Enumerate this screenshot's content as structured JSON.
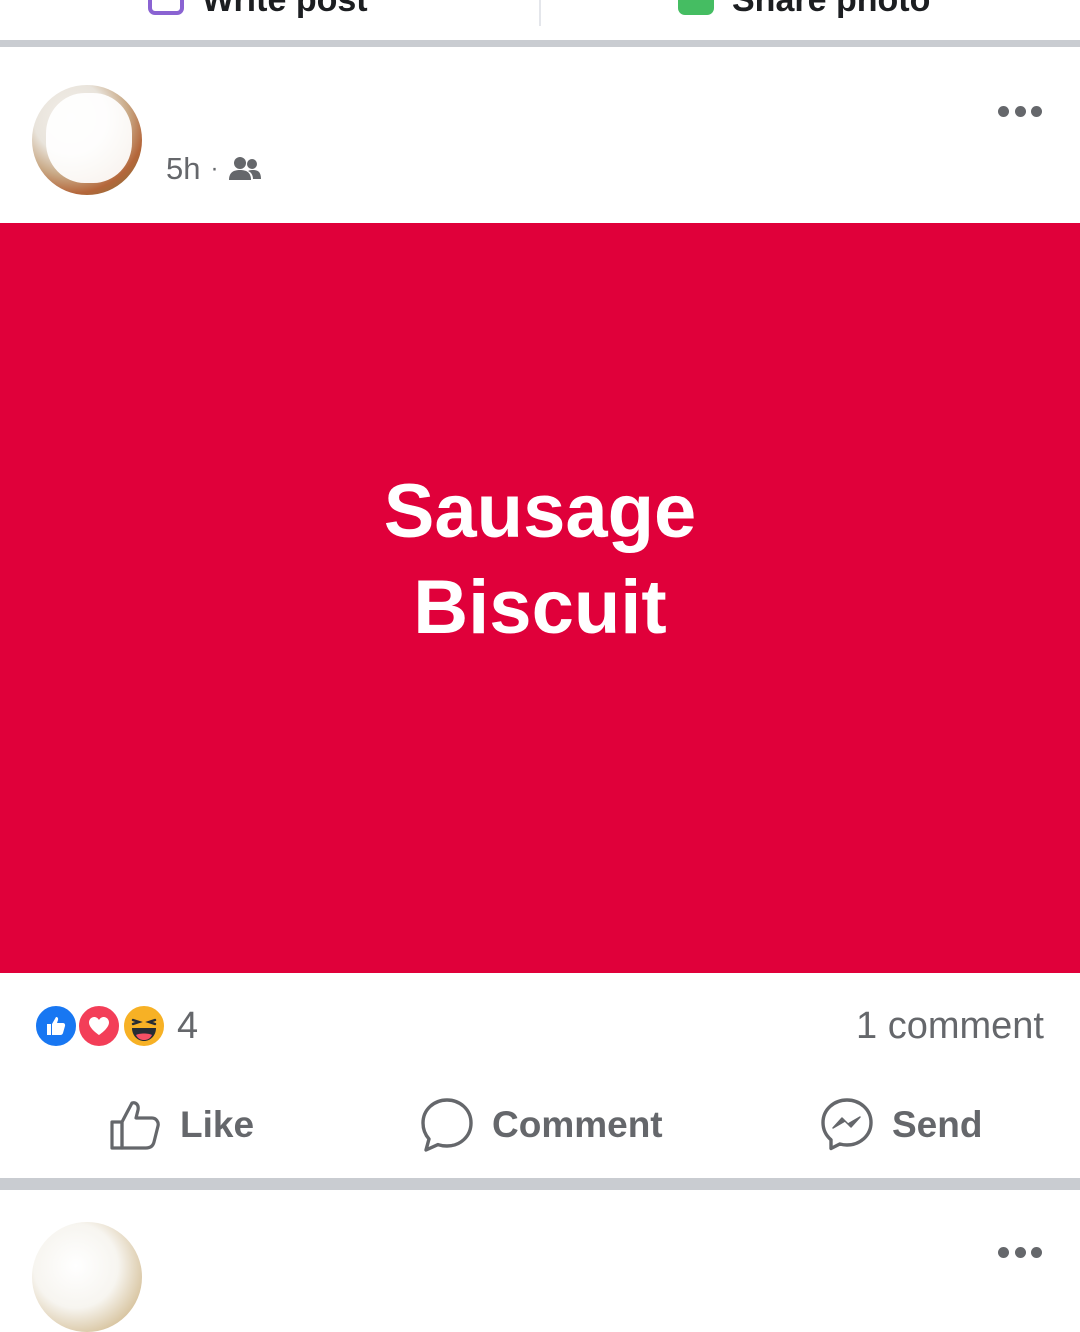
{
  "composer": {
    "write_label": "Write post",
    "photo_label": "Share photo"
  },
  "post": {
    "author": "",
    "time": "5h",
    "separator": "·",
    "audience_icon": "friends-icon",
    "more_icon": "more-options-icon",
    "background_color": "#e0003a",
    "text_line1": "Sausage",
    "text_line2": "Biscuit",
    "reactions": {
      "icons": [
        "like-reaction-icon",
        "love-reaction-icon",
        "haha-reaction-icon"
      ],
      "count": "4"
    },
    "comments_label": "1 comment",
    "actions": {
      "like": "Like",
      "comment": "Comment",
      "send": "Send"
    }
  },
  "next_post": {
    "author": "",
    "more_icon": "more-options-icon"
  },
  "colors": {
    "facebook_blue": "#1877f2",
    "love_red": "#f33e58",
    "haha_yellow": "#f7b125",
    "secondary_text": "#65676b"
  }
}
